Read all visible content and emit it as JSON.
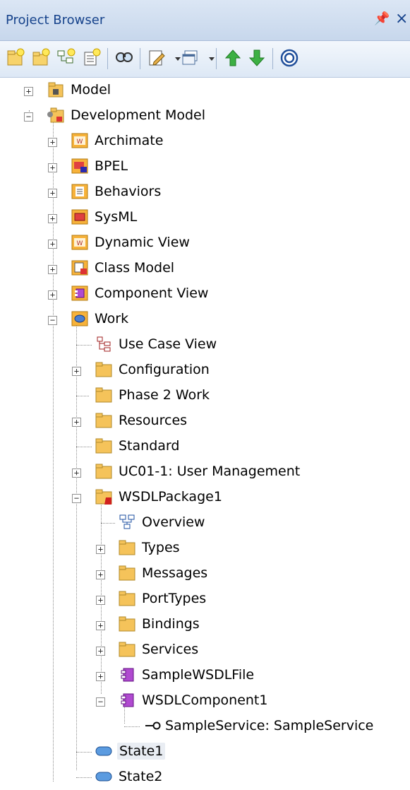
{
  "window": {
    "title": "Project Browser",
    "pin_glyph": "p",
    "close_glyph": "×"
  },
  "toolbar": {
    "buttons": [
      {
        "name": "new-model-icon"
      },
      {
        "name": "new-package-icon"
      },
      {
        "name": "new-diagram-icon"
      },
      {
        "name": "new-element-icon"
      },
      {
        "name": "find-icon"
      },
      {
        "name": "properties-icon"
      },
      {
        "name": "dropdown-icon"
      },
      {
        "name": "view-icon"
      },
      {
        "name": "dropdown-icon"
      },
      {
        "name": "move-up-icon"
      },
      {
        "name": "move-down-icon"
      },
      {
        "name": "help-icon"
      }
    ]
  },
  "tree": {
    "model": "Model",
    "development_model": "Development Model",
    "dev_children": [
      "Archimate",
      "BPEL",
      "Behaviors",
      "SysML",
      "Dynamic View",
      "Class Model",
      "Component View",
      "Work"
    ],
    "work_children": [
      "Use Case View",
      "Configuration",
      "Phase 2 Work",
      "Resources",
      "Standard",
      "UC01-1: User Management",
      "WSDLPackage1"
    ],
    "wsdl_children": [
      "Overview",
      "Types",
      "Messages",
      "PortTypes",
      "Bindings",
      "Services",
      "SampleWSDLFile",
      "WSDLComponent1"
    ],
    "component_children": [
      "SampleService: SampleService"
    ],
    "states": [
      "State1",
      "State2"
    ]
  },
  "colors": {
    "folder": "#f5c35a",
    "title": "#15428b",
    "selection": "#e9edf3"
  }
}
